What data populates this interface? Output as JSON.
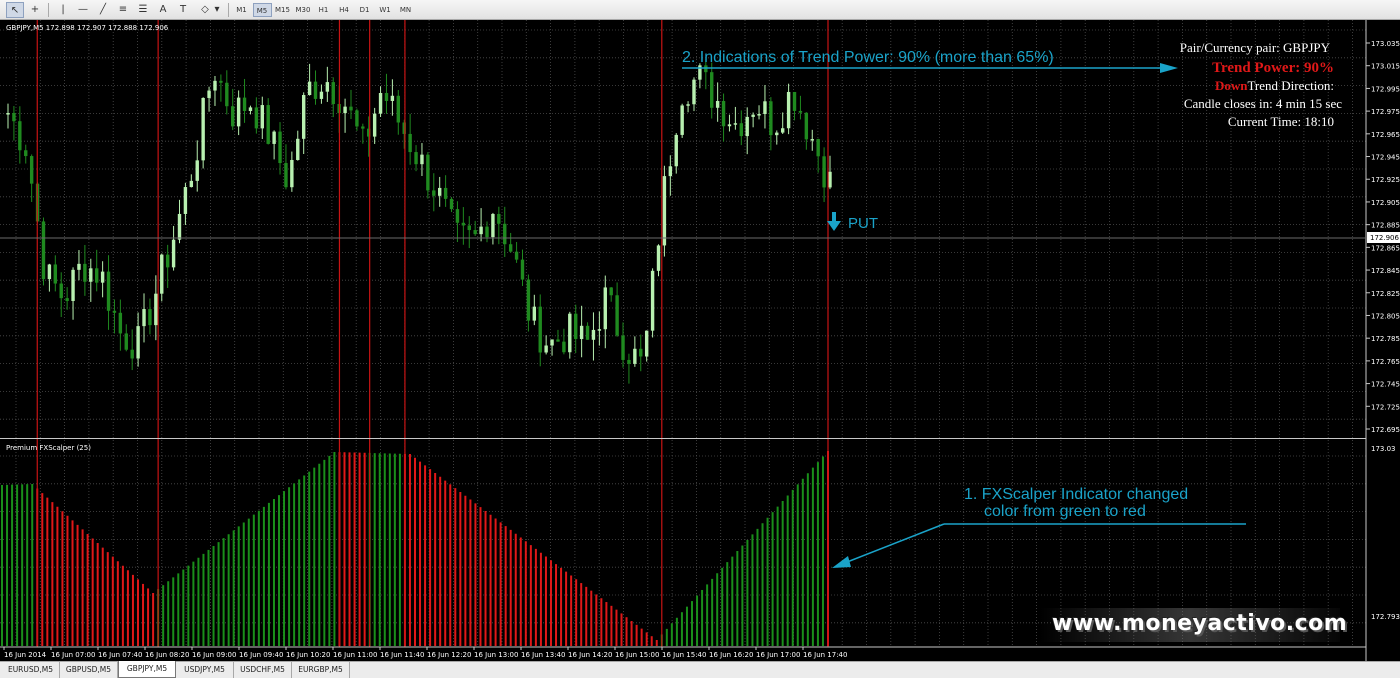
{
  "toolbar": {
    "timeframes": [
      "M1",
      "M5",
      "M15",
      "M30",
      "H1",
      "H4",
      "D1",
      "W1",
      "MN"
    ],
    "active_timeframe": "M5",
    "icons": [
      "cursor-icon",
      "crosshair-icon",
      "vertical-line-icon",
      "horizontal-line-icon",
      "trendline-icon",
      "channel-icon",
      "text-icon",
      "text-label-icon",
      "shapes-icon"
    ]
  },
  "chart_header": "GBPJPY,M5  172.898 172.907 172.888 172.906",
  "indicator_header": "Premium FXScalper (25)",
  "price_axis": {
    "labels": [
      "173.035",
      "173.015",
      "172.995",
      "172.975",
      "172.965",
      "172.945",
      "172.925",
      "172.905",
      "172.885",
      "172.865",
      "172.845",
      "172.825",
      "172.805",
      "172.785",
      "172.765",
      "172.745",
      "172.725",
      "172.695"
    ],
    "current_price": "172.906",
    "indicator_top": "173.03",
    "indicator_bottom": "172.793"
  },
  "time_axis": [
    "16 Jun 2014",
    "16 Jun 07:00",
    "16 Jun 07:40",
    "16 Jun 08:20",
    "16 Jun 09:00",
    "16 Jun 09:40",
    "16 Jun 10:20",
    "16 Jun 11:00",
    "16 Jun 11:40",
    "16 Jun 12:20",
    "16 Jun 13:00",
    "16 Jun 13:40",
    "16 Jun 14:20",
    "16 Jun 15:00",
    "16 Jun 15:40",
    "16 Jun 16:20",
    "16 Jun 17:00",
    "16 Jun 17:40"
  ],
  "overlay": {
    "pair_line": "Pair/Currency pair: GBPJPY",
    "trend_power": "Trend Power: 90%",
    "trend_direction_label": "Trend Direction:",
    "trend_direction_value": "Down",
    "candle_close": "Candle closes in: 4 min 15 sec",
    "current_time": "Current Time: 18:10"
  },
  "annotations": {
    "trend_note": "2. Indications of Trend Power: 90% (more than 65%)",
    "indicator_note_1": "1. FXScalper Indicator changed",
    "indicator_note_2": "color from green to red",
    "put_label": "PUT"
  },
  "watermark": "www.moneyactivo.com",
  "symbol_tabs": [
    "EURUSD,M5",
    "GBPUSD,M5",
    "GBPJPY,M5",
    "USDJPY,M5",
    "USDCHF,M5",
    "EURGBP,M5"
  ],
  "active_tab": "GBPJPY,M5",
  "colors": {
    "background": "#000000",
    "grid": "#4c4c4c",
    "bull_candle": "#b8f0b0",
    "bear_candle": "#1f8a1f",
    "histogram_green": "#1a8f1a",
    "histogram_red": "#e01818",
    "signal_line": "#c81414",
    "annotation": "#1aa3c9",
    "trend_power_text": "#e01818"
  },
  "chart_data": {
    "type": "candlestick",
    "symbol": "GBPJPY",
    "timeframe": "M5",
    "ylim": [
      172.69,
      173.05
    ],
    "close_estimates": [
      172.97,
      172.94,
      172.83,
      172.81,
      172.84,
      172.83,
      172.78,
      172.77,
      172.82,
      172.87,
      172.93,
      173.01,
      172.97,
      172.98,
      172.95,
      172.91,
      172.99,
      173.0,
      172.98,
      172.94,
      172.99,
      172.96,
      172.93,
      172.9,
      172.86,
      172.86,
      172.89,
      172.85,
      172.79,
      172.77,
      172.78,
      172.77,
      172.81,
      172.77,
      172.75,
      172.89,
      172.99,
      173.0,
      172.98,
      172.96,
      172.98,
      172.96,
      172.99,
      172.95,
      172.91
    ],
    "indicator": {
      "name": "Premium FXScalper (25)",
      "bar_count": 165,
      "color_changes": [
        {
          "bar": 7,
          "to": "red"
        },
        {
          "bar": 31,
          "to": "green"
        },
        {
          "bar": 67,
          "to": "red"
        },
        {
          "bar": 73,
          "to": "green"
        },
        {
          "bar": 80,
          "to": "red"
        },
        {
          "bar": 131,
          "to": "green"
        },
        {
          "bar": 164,
          "to": "red"
        }
      ]
    }
  }
}
